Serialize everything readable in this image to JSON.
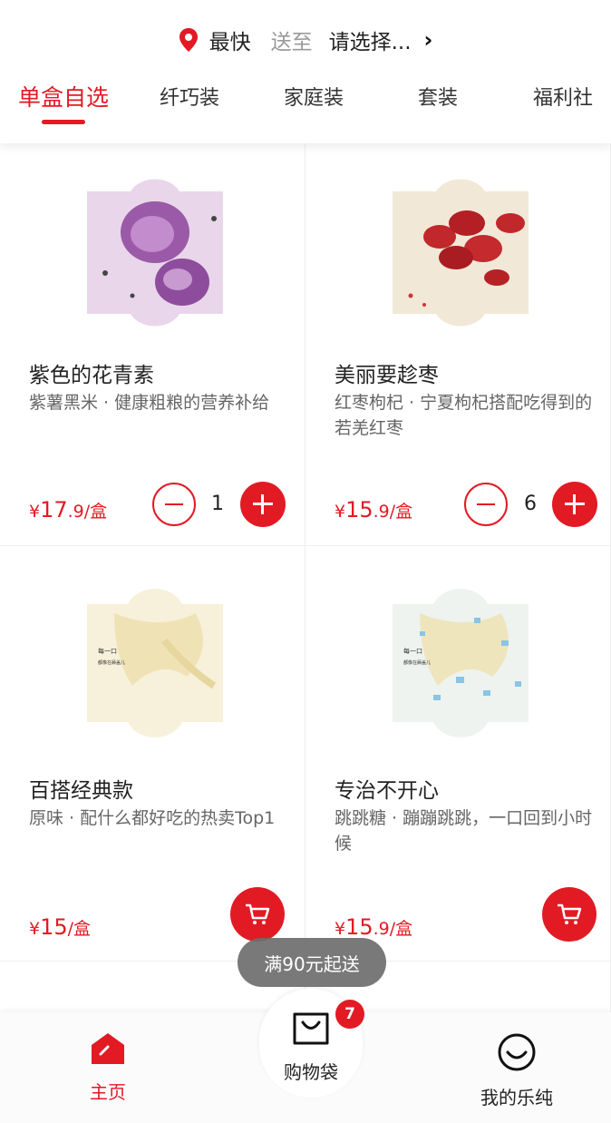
{
  "header": {
    "speed_label": "最快",
    "sendto_label": "送至",
    "address_placeholder": "请选择...",
    "chevron": "›"
  },
  "tabs": [
    {
      "label": "单盒自选",
      "active": true
    },
    {
      "label": "纤巧装",
      "active": false
    },
    {
      "label": "家庭装",
      "active": false
    },
    {
      "label": "套装",
      "active": false
    },
    {
      "label": "福利社",
      "active": false
    }
  ],
  "products": [
    {
      "name": "紫色的花青素",
      "desc": "紫薯黑米 · 健康粗粮的营养补给",
      "currency": "¥",
      "price_main": "17",
      "price_dec": ".9",
      "unit": "/盒",
      "qty": "1",
      "image": "purple-sweet-potato"
    },
    {
      "name": "美丽要趁枣",
      "desc": "红枣枸杞 · 宁夏枸杞搭配吃得到的若羌红枣",
      "currency": "¥",
      "price_main": "15",
      "price_dec": ".9",
      "unit": "/盒",
      "qty": "6",
      "image": "red-dates"
    },
    {
      "name": "百搭经典款",
      "desc": "原味 · 配什么都好吃的热卖Top1",
      "currency": "¥",
      "price_main": "15",
      "price_dec": "",
      "unit": "/盒",
      "image": "plain-yogurt"
    },
    {
      "name": "专治不开心",
      "desc": "跳跳糖 · 蹦蹦跳跳，一口回到小时候",
      "currency": "¥",
      "price_main": "15",
      "price_dec": ".9",
      "unit": "/盒",
      "image": "popping-candy"
    }
  ],
  "box_text": "每一口都像在舔盖儿",
  "toast": "满90元起送",
  "bottom_nav": {
    "home": "主页",
    "bag": "购物袋",
    "bag_count": "7",
    "mine": "我的乐纯"
  },
  "colors": {
    "accent": "#e21a24",
    "muted": "#999999"
  }
}
